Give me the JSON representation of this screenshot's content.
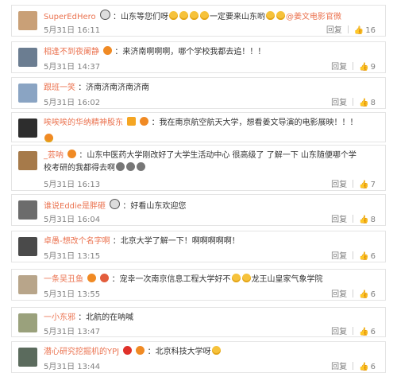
{
  "comments": [
    {
      "user": "SuperEdHero",
      "text_before": "：山东等您们呀",
      "text_after": "一定要来山东哟",
      "mention": "@姜文电影官微",
      "time": "5月31日 16:11",
      "reply": "回复",
      "likes": "16",
      "avatar_color": "#c9a077"
    },
    {
      "user": "相逢不到夜阑静",
      "text": "：来济南啊啊啊，哪个学校我都去追！！！",
      "time": "5月31日 14:37",
      "reply": "回复",
      "likes": "9",
      "avatar_color": "#6b7d91"
    },
    {
      "user": "跟班一笑",
      "text": "：济南济南济南济南",
      "time": "5月31日 16:02",
      "reply": "回复",
      "likes": "8",
      "avatar_color": "#8aa4c3"
    },
    {
      "user": "唉唉唉的华纳精神股东",
      "text": "：我在南京航空航天大学，想看姜文导演的电影展映！！！",
      "time": "",
      "reply": "",
      "likes": "",
      "avatar_color": "#2d2d2d"
    },
    {
      "user": "_芸呐",
      "text": "：山东中医药大学刚改好了大学生活动中心 很高级了 了解一下 山东随便哪个学",
      "text2": "校考研的我都得去啊",
      "time": "5月31日 16:13",
      "reply": "回复",
      "likes": "7",
      "avatar_color": "#a67a4a"
    },
    {
      "user": "谁说Eddie是胖砸",
      "text": "：好看山东欢迎您",
      "time": "5月31日 16:04",
      "reply": "回复",
      "likes": "8",
      "avatar_color": "#6c6c6c"
    },
    {
      "user": "卓愚-想改个名字啊",
      "text": "：北京大学了解一下！啊啊啊啊啊！",
      "time": "5月31日 13:15",
      "reply": "回复",
      "likes": "6",
      "avatar_color": "#4a4a4a"
    },
    {
      "user": "一条吴丑鱼",
      "text_before": "：宠幸一次南京信息工程大学好不",
      "text_after": "龙王山皇家气象学院",
      "time": "5月31日 13:55",
      "reply": "回复",
      "likes": "6",
      "avatar_color": "#b8a58a"
    },
    {
      "user": "一小东邪",
      "text": "：北航的在呐喊",
      "time": "5月31日 13:47",
      "reply": "回复",
      "likes": "6",
      "avatar_color": "#9aa17c"
    },
    {
      "user": "潜心研究挖掘机的YPJ",
      "text": "：北京科技大学呀",
      "time": "5月31日 13:44",
      "reply": "回复",
      "likes": "6",
      "avatar_color": "#5b6b5d"
    }
  ],
  "colors": {
    "username": "#eb7350",
    "text": "#333333",
    "meta": "#808080",
    "border": "#e4e4e4"
  },
  "icons": {
    "like": "thumb-up-icon"
  }
}
